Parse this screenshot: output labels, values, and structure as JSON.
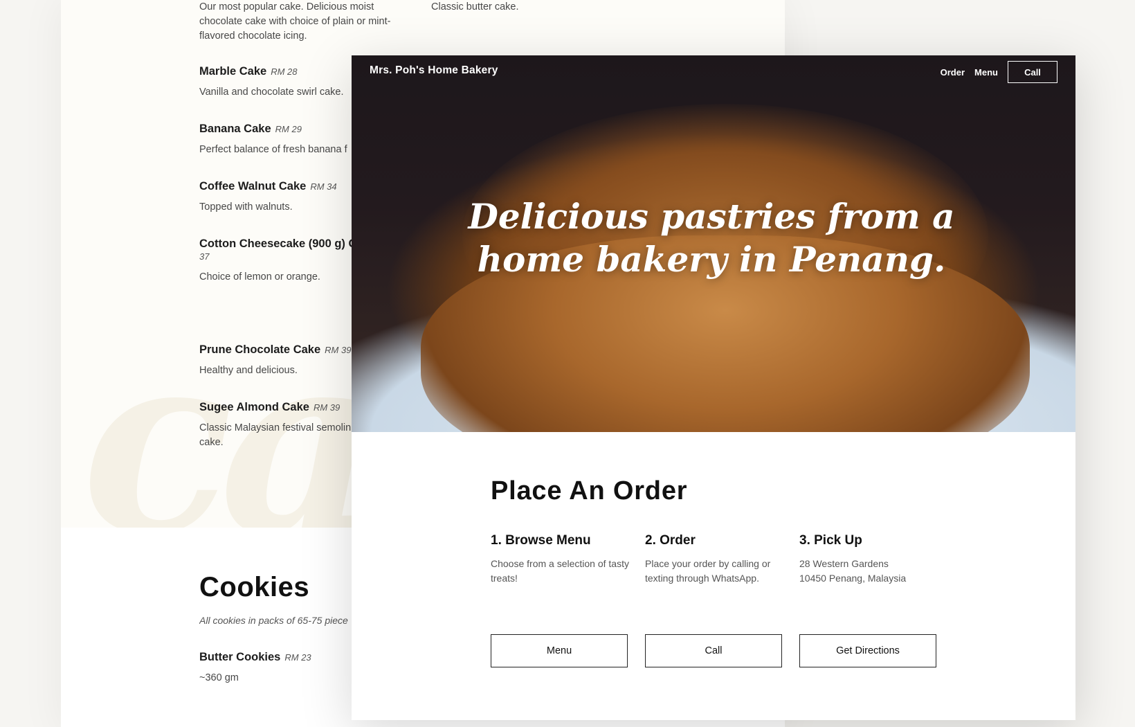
{
  "menu_page": {
    "top_desc_left": "Our most popular cake. Delicious moist chocolate cake with choice of plain or mint-flavored chocolate icing.",
    "top_desc_right": "Classic butter cake.",
    "watermark": "ca",
    "items": [
      {
        "name": "Marble Cake",
        "price": "RM 28",
        "desc": "Vanilla and chocolate swirl cake."
      },
      {
        "name": "Banana Cake",
        "price": "RM 29",
        "desc": "Perfect balance of fresh banana f"
      },
      {
        "name": "Coffee Walnut Cake",
        "price": "RM 34",
        "desc": "Topped with walnuts."
      },
      {
        "name": "Cotton Cheesecake (900 g) C",
        "price": "37",
        "desc": "Choice of lemon or orange."
      },
      {
        "name": "Prune Chocolate Cake",
        "price": "RM 39",
        "desc": "Healthy and delicious."
      },
      {
        "name": "Sugee Almond Cake",
        "price": "RM 39",
        "desc": "Classic Malaysian festival semolin cake."
      }
    ],
    "cookies": {
      "heading": "Cookies",
      "note": "All cookies in packs of 65-75 piece",
      "item": {
        "name": "Butter Cookies",
        "price": "RM 23",
        "desc": "~360 gm"
      }
    }
  },
  "home_page": {
    "site_title": "Mrs. Poh's Home Bakery",
    "nav": {
      "order": "Order",
      "menu": "Menu",
      "call": "Call"
    },
    "hero_headline": "Delicious pastries from a home bakery in Penang.",
    "order_section": {
      "heading": "Place An Order",
      "steps": [
        {
          "title": "1. Browse Menu",
          "desc": "Choose from a selection of tasty treats!"
        },
        {
          "title": "2. Order",
          "desc": "Place your order by calling or texting through WhatsApp."
        },
        {
          "title": "3. Pick Up",
          "desc": "28 Western Gardens\n10450 Penang, Malaysia"
        }
      ],
      "buttons": [
        "Menu",
        "Call",
        "Get Directions"
      ]
    }
  },
  "colors": {
    "back_page_bg": "#fdfcf8",
    "hero_dark": "#1d171b",
    "text_dark": "#111111"
  }
}
